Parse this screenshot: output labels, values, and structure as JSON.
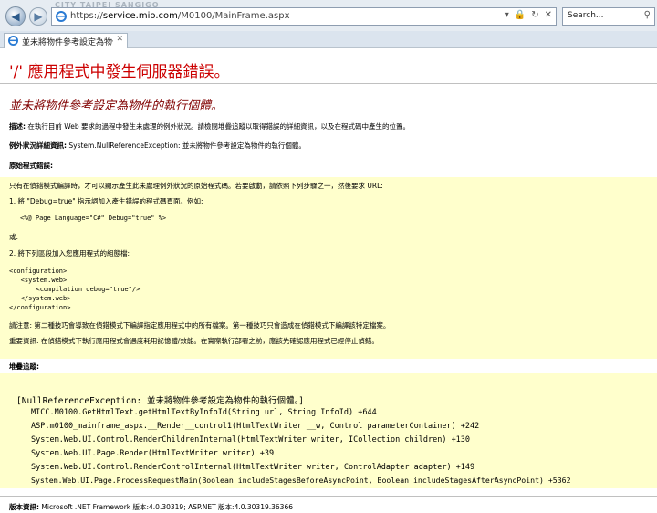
{
  "browser": {
    "watermark": "CITY TAIPEI SANGIGO",
    "url_prefix": "https://",
    "url_host": "service.mio.com",
    "url_path": "/M0100/MainFrame.aspx",
    "search_placeholder": "Search...",
    "tab_title": "並未將物件參考設定為物件..."
  },
  "page": {
    "heading": "'/' 應用程式中發生伺服器錯誤。",
    "subheading": "並未將物件參考設定為物件的執行個體。",
    "desc_label": "描述:",
    "desc_text": " 在執行目前 Web 要求的過程中發生未處理的例外狀況。請檢閱堆疊追蹤以取得錯誤的詳細資訊，以及在程式碼中產生的位置。",
    "exc_label": "例外狀況詳細資訊:",
    "exc_text": " System.NullReferenceException: 並未將物件參考設定為物件的執行個體。",
    "source_label": "原始程式錯誤:",
    "source_box": {
      "intro": "只有在偵錯模式編譯時，才可以顯示產生此未處理例外狀況的原始程式碼。若要啟動，請依照下列步驟之一，然後要求 URL:",
      "step1": "1. 將 \"Debug=true\" 指示詞加入產生錯誤的程式碼頁面。例如:",
      "code1": "<%@ Page Language=\"C#\" Debug=\"true\" %>",
      "or": "或:",
      "step2": "2. 將下列區段加入您應用程式的組態檔:",
      "config": [
        "<configuration>",
        "   <system.web>",
        "       <compilation debug=\"true\"/>",
        "   </system.web>",
        "</configuration>"
      ],
      "note1": "請注意: 第二種技巧會導致在偵錯模式下編譯指定應用程式中的所有檔案。第一種技巧只會造成在偵錯模式下編譯該特定檔案。",
      "note2": "重要資訊: 在偵錯模式下執行應用程式會遇度耗用記憶體/效能。在實際執行部署之前，應該先確認應用程式已經停止偵錯。"
    },
    "stack_label": "堆疊追蹤:",
    "stack": [
      "[NullReferenceException: 並未將物件參考設定為物件的執行個體。]",
      "MICC.M0100.GetHtmlText.getHtmlTextByInfoId(String url, String InfoId) +644",
      "ASP.m0100_mainframe_aspx.__Render__control1(HtmlTextWriter __w, Control parameterContainer) +242",
      "System.Web.UI.Control.RenderChildrenInternal(HtmlTextWriter writer, ICollection children) +130",
      "System.Web.UI.Page.Render(HtmlTextWriter writer) +39",
      "System.Web.UI.Control.RenderControlInternal(HtmlTextWriter writer, ControlAdapter adapter) +149",
      "System.Web.UI.Page.ProcessRequestMain(Boolean includeStagesBeforeAsyncPoint, Boolean includeStagesAfterAsyncPoint) +5362"
    ],
    "version_label": "版本資訊:",
    "version_text": " Microsoft .NET Framework 版本:4.0.30319; ASP.NET 版本:4.0.30319.36366"
  },
  "colors": {
    "heading": "#cc0000",
    "subheading": "#800000",
    "code_box": "#ffffcc"
  },
  "icons": [
    "back-icon",
    "forward-icon",
    "ie-favicon",
    "search-icon",
    "lock-icon",
    "refresh-icon",
    "close-icon"
  ]
}
